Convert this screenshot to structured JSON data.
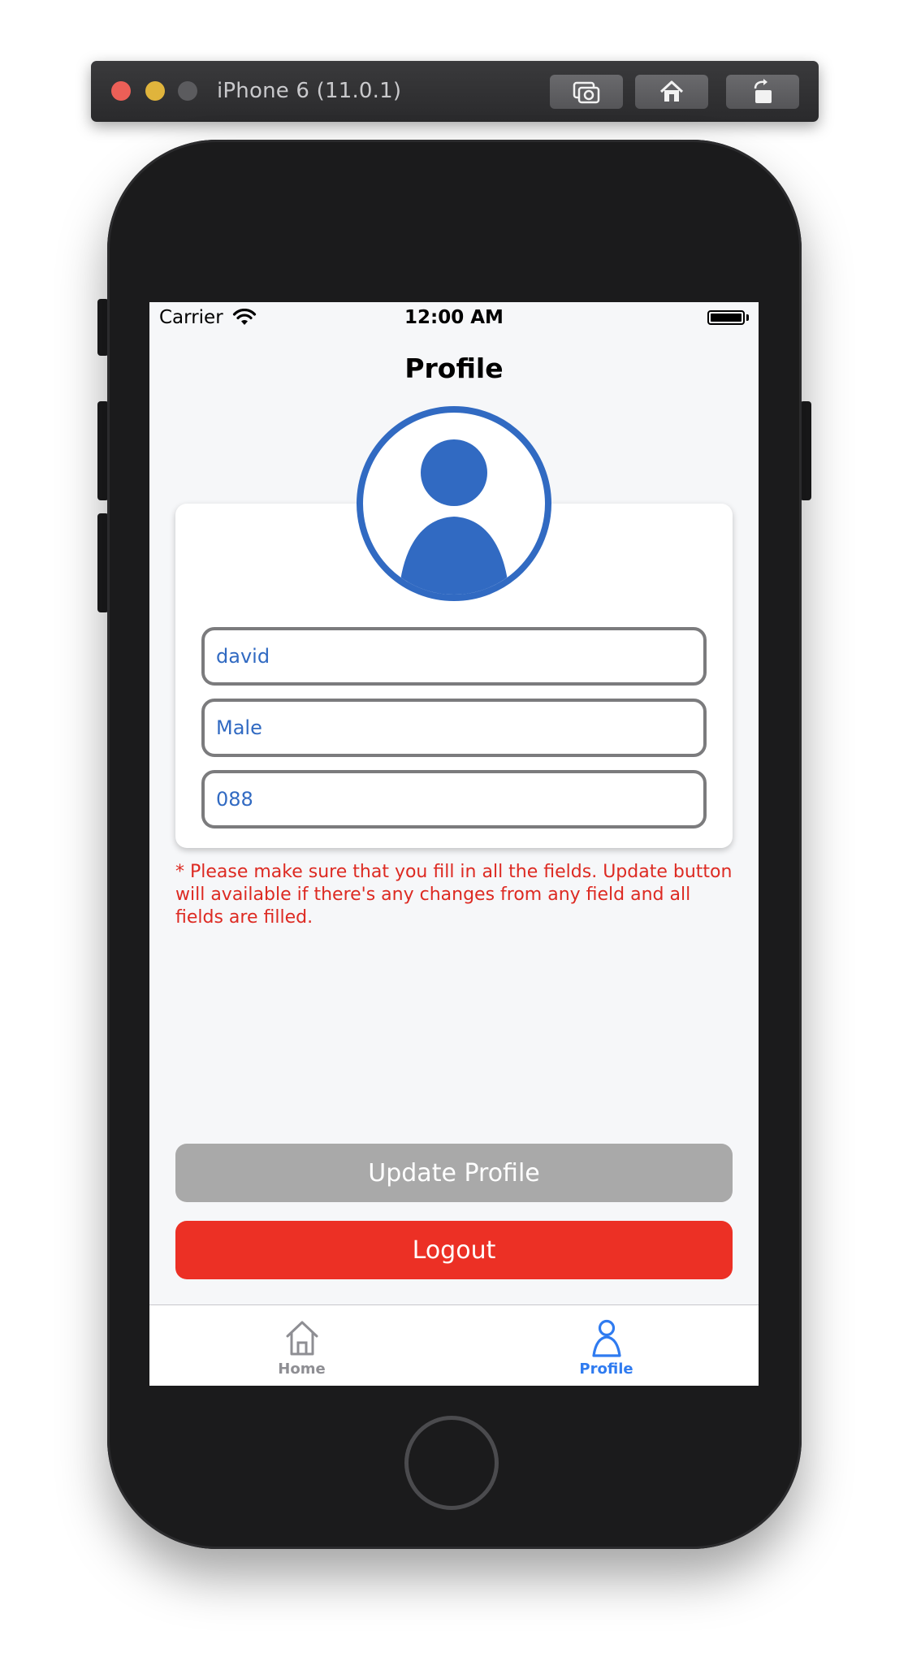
{
  "simulator": {
    "title": "iPhone 6 (11.0.1)",
    "buttons": [
      "screenshot-icon",
      "home-icon",
      "rotate-icon"
    ]
  },
  "status_bar": {
    "carrier": "Carrier",
    "time": "12:00 AM"
  },
  "page": {
    "title": "Profile"
  },
  "profile_form": {
    "name_value": "david",
    "gender_value": "Male",
    "phone_value": "088"
  },
  "hint_text": "* Please make sure that you fill in all the fields. Update button will available if there's any changes from any field and all fields are filled.",
  "actions": {
    "update_label": "Update Profile",
    "logout_label": "Logout"
  },
  "tabbar": {
    "tabs": [
      {
        "label": "Home",
        "icon": "home-icon",
        "active": false
      },
      {
        "label": "Profile",
        "icon": "person-icon",
        "active": true
      }
    ]
  },
  "colors": {
    "accent_blue": "#316ac2",
    "tab_active": "#2f7bf0",
    "logout_red": "#ec3025",
    "hint_red": "#dd2a22",
    "disabled_gray": "#a9a9a9"
  }
}
